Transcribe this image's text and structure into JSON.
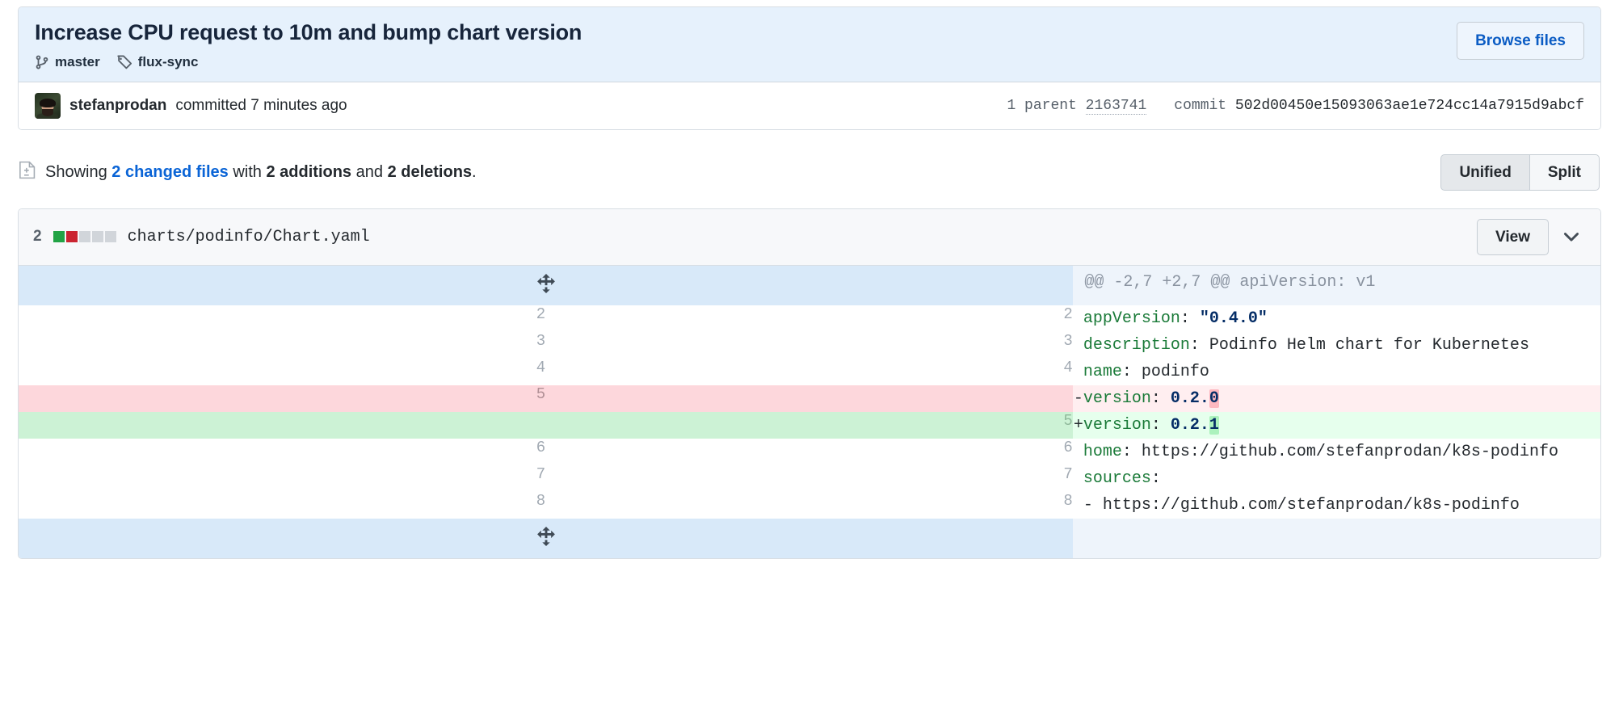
{
  "commit": {
    "title": "Increase CPU request to 10m and bump chart version",
    "branch_icon": "git-branch-icon",
    "branch": "master",
    "tag_icon": "tag-icon",
    "tag": "flux-sync",
    "browse_files_label": "Browse files",
    "author": "stefanprodan",
    "committed_text": "committed 7 minutes ago",
    "parent_label": "1 parent",
    "parent_sha": "2163741",
    "commit_label": "commit",
    "commit_sha": "502d00450e15093063ae1e724cc14a7915d9abcf"
  },
  "showing": {
    "file_icon": "diff-file-icon",
    "prefix": "Showing",
    "changed_files": "2 changed files",
    "with_word": "with",
    "additions": "2 additions",
    "and_word": "and",
    "deletions": "2 deletions",
    "period": ".",
    "unified_label": "Unified",
    "split_label": "Split",
    "selected_view": "Unified"
  },
  "file": {
    "diffstat_count": "2",
    "diffstat_blocks": [
      "add",
      "del",
      "none",
      "none",
      "none"
    ],
    "path": "charts/podinfo/Chart.yaml",
    "view_label": "View",
    "chevron_icon": "chevron-down-icon",
    "expand_icon": "unfold-icon"
  },
  "diff": {
    "hunk_header": "@@ -2,7 +2,7 @@ apiVersion: v1",
    "rows": [
      {
        "type": "hunk",
        "old": "",
        "new": "",
        "text": "@@ -2,7 +2,7 @@ apiVersion: v1"
      },
      {
        "type": "ctx",
        "old": "2",
        "new": "2",
        "marker": " ",
        "key": "appVersion",
        "sep": ": ",
        "value": "\"0.4.0\"",
        "text": " appVersion: \"0.4.0\""
      },
      {
        "type": "ctx",
        "old": "3",
        "new": "3",
        "marker": " ",
        "key": "description",
        "sep": ": ",
        "value": "Podinfo Helm chart for Kubernetes",
        "plain_value": true,
        "text": " description: Podinfo Helm chart for Kubernetes"
      },
      {
        "type": "ctx",
        "old": "4",
        "new": "4",
        "marker": " ",
        "key": "name",
        "sep": ": ",
        "value": "podinfo",
        "plain_value": true,
        "text": " name: podinfo"
      },
      {
        "type": "del",
        "old": "5",
        "new": "",
        "marker": "-",
        "key": "version",
        "sep": ": ",
        "value": "0.2.",
        "highlight": "0",
        "text": "-version: 0.2.0"
      },
      {
        "type": "add",
        "old": "",
        "new": "5",
        "marker": "+",
        "key": "version",
        "sep": ": ",
        "value": "0.2.",
        "highlight": "1",
        "text": "+version: 0.2.1"
      },
      {
        "type": "ctx",
        "old": "6",
        "new": "6",
        "marker": " ",
        "key": "home",
        "sep": ": ",
        "value": "https://github.com/stefanprodan/k8s-podinfo",
        "plain_value": true,
        "text": " home: https://github.com/stefanprodan/k8s-podinfo"
      },
      {
        "type": "ctx",
        "old": "7",
        "new": "7",
        "marker": " ",
        "key": "sources",
        "sep": ":",
        "value": "",
        "plain_value": true,
        "text": " sources:"
      },
      {
        "type": "ctx",
        "old": "8",
        "new": "8",
        "marker": " ",
        "key": "",
        "sep": "",
        "value": "- https://github.com/stefanprodan/k8s-podinfo",
        "plain_value": true,
        "text": " - https://github.com/stefanprodan/k8s-podinfo"
      },
      {
        "type": "hunk-bottom",
        "old": "",
        "new": "",
        "text": ""
      }
    ]
  },
  "colors": {
    "header_bg": "#e6f1fc",
    "link": "#0a64d6",
    "addition_bg": "#e6ffed",
    "deletion_bg": "#ffeef0",
    "addition_block": "#22a345",
    "deletion_block": "#cb2431",
    "yaml_key": "#1a7a38",
    "yaml_value": "#052d66"
  }
}
